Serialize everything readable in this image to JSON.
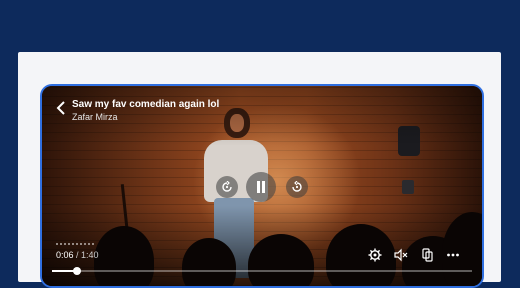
{
  "video": {
    "title": "Saw my fav comedian again lol",
    "author": "Zafar Mirza",
    "current_time": "0:06",
    "duration": "/ 1:40",
    "progress_fraction": 0.06
  },
  "controls": {
    "back": "back-icon",
    "rewind": "replay-icon",
    "play_pause": "pause-icon",
    "forward": "forward-icon",
    "settings": "gear-icon",
    "mute": "mute-icon",
    "cast": "cast-icon",
    "more": "more-icon"
  },
  "colors": {
    "page_bg": "#0d2a5c",
    "card_bg": "#f4f5f8",
    "player_border": "#2f6fe0"
  }
}
